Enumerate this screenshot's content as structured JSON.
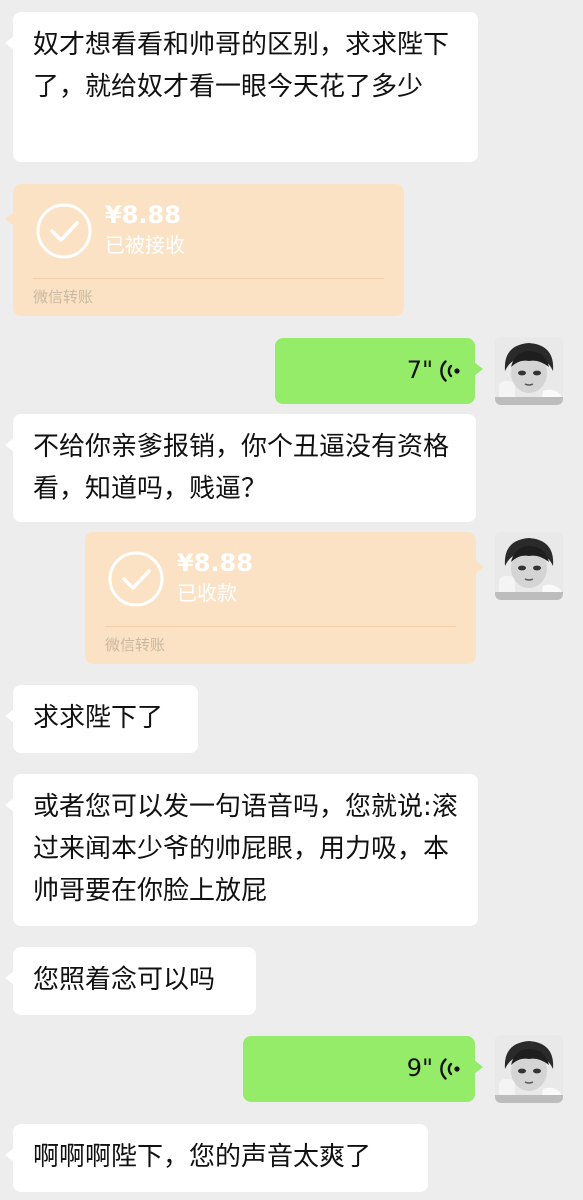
{
  "colors": {
    "background": "#ededed",
    "incoming_bubble": "#ffffff",
    "outgoing_voice_bubble": "#95ec69",
    "transfer_card": "#fce2c4"
  },
  "messages": [
    {
      "type": "text",
      "direction": "incoming",
      "text": "奴才想看看和帅哥的区别，求求陛下了，就给奴才看一眼今天花了多少"
    },
    {
      "type": "transfer",
      "direction": "incoming",
      "amount": "¥8.88",
      "status": "已被接收",
      "footer": "微信转账",
      "icon": "check-circle-icon"
    },
    {
      "type": "voice",
      "direction": "outgoing",
      "duration": "7\"",
      "icon": "voice-wave-icon"
    },
    {
      "type": "text",
      "direction": "incoming",
      "text": "不给你亲爹报销，你个丑逼没有资格看，知道吗，贱逼？"
    },
    {
      "type": "transfer",
      "direction": "outgoing",
      "amount": "¥8.88",
      "status": "已收款",
      "footer": "微信转账",
      "icon": "check-circle-icon"
    },
    {
      "type": "text",
      "direction": "incoming",
      "text": "求求陛下了"
    },
    {
      "type": "text",
      "direction": "incoming",
      "text": "或者您可以发一句语音吗，您就说:滚过来闻本少爷的帅屁眼，用力吸，本帅哥要在你脸上放屁"
    },
    {
      "type": "text",
      "direction": "incoming",
      "text": "您照着念可以吗"
    },
    {
      "type": "voice",
      "direction": "outgoing",
      "duration": "9\"",
      "icon": "voice-wave-icon"
    },
    {
      "type": "text",
      "direction": "incoming",
      "text": "啊啊啊陛下，您的声音太爽了"
    }
  ]
}
